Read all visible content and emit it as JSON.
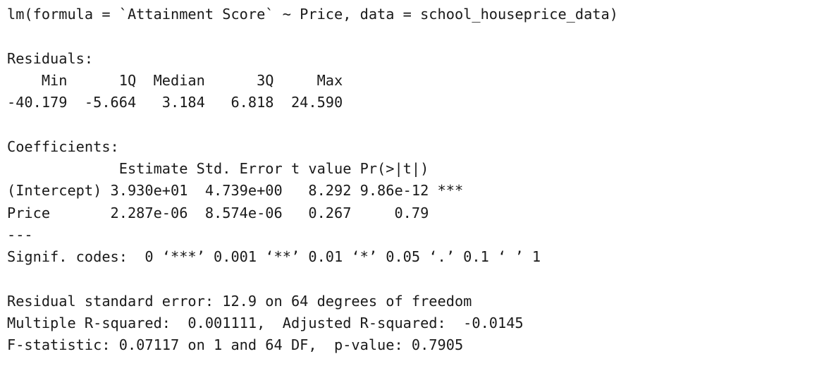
{
  "console": {
    "lines": [
      "lm(formula = `Attainment Score` ~ Price, data = school_houseprice_data)",
      "",
      "Residuals:",
      "    Min      1Q  Median      3Q     Max ",
      "-40.179  -5.664   3.184   6.818  24.590 ",
      "",
      "Coefficients:",
      "             Estimate Std. Error t value Pr(>|t|)    ",
      "(Intercept) 3.930e+01  4.739e+00   8.292 9.86e-12 ***",
      "Price       2.287e-06  8.574e-06   0.267     0.79    ",
      "---",
      "Signif. codes:  0 ‘***’ 0.001 ‘**’ 0.01 ‘*’ 0.05 ‘.’ 0.1 ‘ ’ 1",
      "",
      "Residual standard error: 12.9 on 64 degrees of freedom",
      "Multiple R-squared:  0.001111,\tAdjusted R-squared:  -0.0145 ",
      "F-statistic: 0.07117 on 1 and 64 DF,  p-value: 0.7905"
    ]
  }
}
